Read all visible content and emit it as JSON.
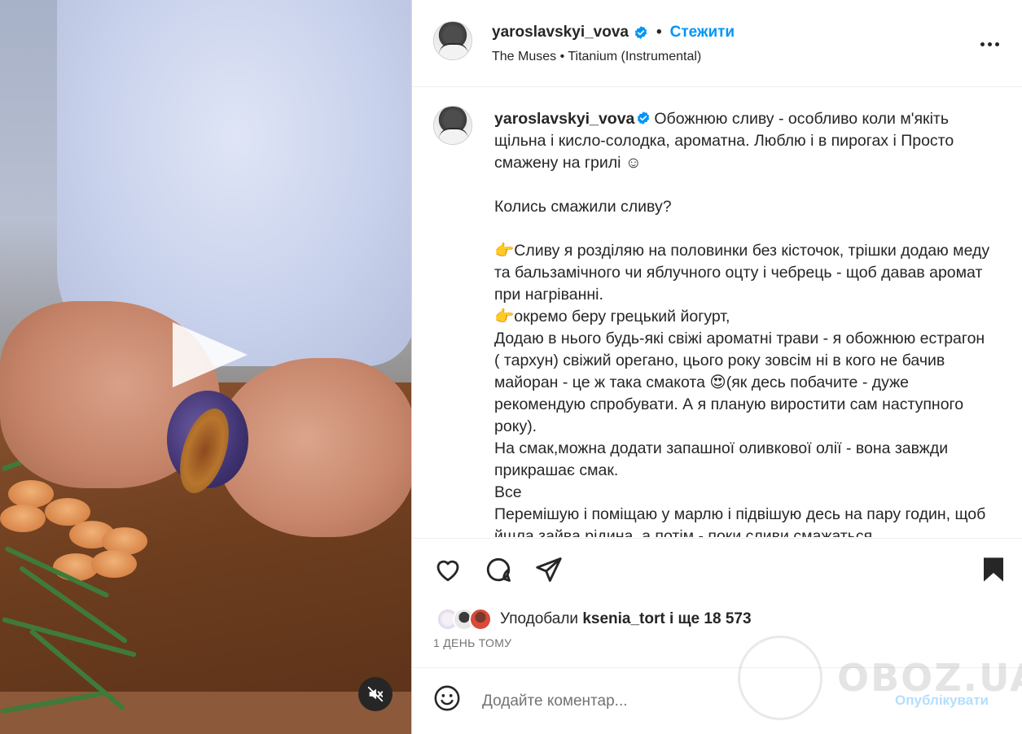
{
  "post": {
    "username": "yaroslavskyi_vova",
    "verified": true,
    "follow_label": "Стежити",
    "dot": "•",
    "music": "The Muses • Titanium (Instrumental)"
  },
  "caption": {
    "username": "yaroslavskyi_vova",
    "text": "Обожнюю сливу - особливо коли м'якіть щільна і кисло-солодка, ароматна. Люблю і в пирогах і Просто смажену на грилі ☺\n\nКолись смажили сливу?\n\n👉Сливу я розділяю на половинки без кісточок, трішки додаю меду та бальзамічного чи яблучного оцту і чебрець - щоб давав аромат при нагріванні.\n👉окремо беру грецький йогурт,\nДодаю в нього будь-які свіжі ароматні трави - я обожнюю естрагон ( тархун) свіжий орегано, цього року зовсім ні в кого не бачив майоран - це ж така смакота 😍(як десь побачите - дуже рекомендую спробувати. А я планую виростити сам наступного року).\nНа смак,можна додати запашної оливкової олії - вона завжди прикрашає смак.\nВсе\nПеремішую і поміщаю у марлю і підвішую десь на пару годин, щоб йшла зайва рідина, а потім - поки сливи смажаться"
  },
  "likes": {
    "prefix": "Уподобали",
    "user": "ksenia_tort",
    "suffix": "і ще 18 573"
  },
  "timestamp": "1 ДЕНЬ ТОМУ",
  "comment": {
    "placeholder": "Додайте коментар...",
    "post_label": "Опублікувати"
  },
  "watermark": "OBOZ.UA",
  "colors": {
    "accent": "#0095f6",
    "text": "#262626",
    "muted": "#737373",
    "post_disabled": "#b2dffc"
  },
  "icons": [
    "play-icon",
    "mute-icon",
    "more-icon",
    "verified-icon",
    "heart-icon",
    "comment-icon",
    "share-icon",
    "save-icon",
    "emoji-icon"
  ]
}
